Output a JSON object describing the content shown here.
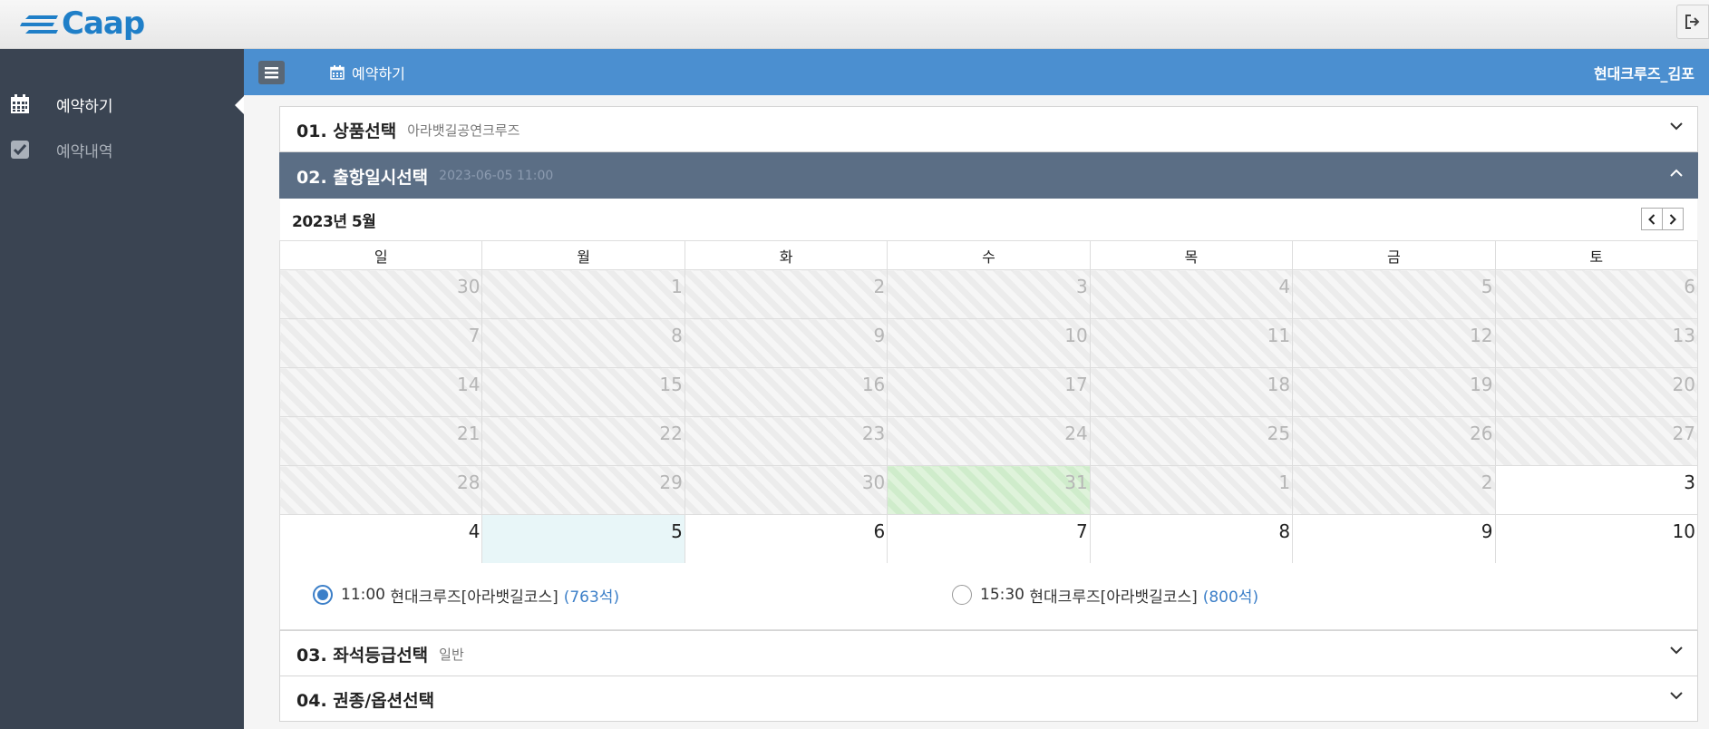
{
  "header": {
    "logo_text": "Caap",
    "logout_icon": "sign-out-icon"
  },
  "sidebar": {
    "items": [
      {
        "label": "예약하기",
        "icon": "calendar-icon",
        "active": true
      },
      {
        "label": "예약내역",
        "icon": "check-square-icon",
        "active": false
      }
    ]
  },
  "topbar": {
    "menu_icon": "hamburger-icon",
    "title": "예약하기",
    "title_icon": "calendar-icon",
    "user": "현대크루즈_김포"
  },
  "steps": [
    {
      "num": "01. 상품선택",
      "sub": "아라뱃길공연크루즈"
    },
    {
      "num": "02. 출항일시선택",
      "sub": "2023-06-05 11:00"
    },
    {
      "num": "03. 좌석등급선택",
      "sub": "일반"
    },
    {
      "num": "04. 권종/옵션선택",
      "sub": ""
    }
  ],
  "calendar": {
    "title": "2023년 5월",
    "weekdays": [
      "일",
      "월",
      "화",
      "수",
      "목",
      "금",
      "토"
    ],
    "weeks": [
      [
        "30",
        "1",
        "2",
        "3",
        "4",
        "5",
        "6"
      ],
      [
        "7",
        "8",
        "9",
        "10",
        "11",
        "12",
        "13"
      ],
      [
        "14",
        "15",
        "16",
        "17",
        "18",
        "19",
        "20"
      ],
      [
        "21",
        "22",
        "23",
        "24",
        "25",
        "26",
        "27"
      ],
      [
        "28",
        "29",
        "30",
        "31",
        "1",
        "2",
        "3"
      ],
      [
        "4",
        "5",
        "6",
        "7",
        "8",
        "9",
        "10"
      ]
    ]
  },
  "times": [
    {
      "time": "11:00",
      "name": "현대크루즈[아라뱃길코스]",
      "seats": "(763석)",
      "selected": true
    },
    {
      "time": "15:30",
      "name": "현대크루즈[아라뱃길코스]",
      "seats": "(800석)",
      "selected": false
    }
  ],
  "colors": {
    "sidebar_bg": "#3a4452",
    "topbar_blue": "#4b8fd0",
    "active_step_bg": "#5b6e85",
    "accent": "#3c7fc8"
  }
}
